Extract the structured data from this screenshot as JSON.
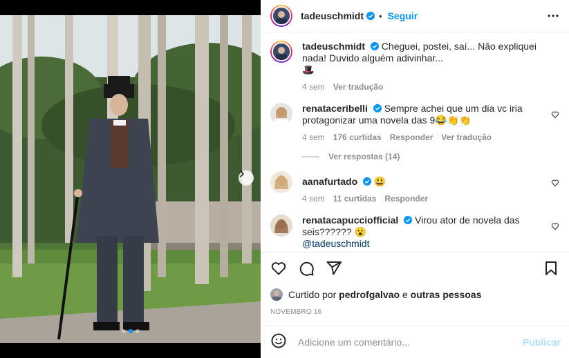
{
  "post": {
    "author": "tadeuschmidt",
    "separator": "•",
    "follow_label": "Seguir",
    "caption": {
      "text": "Cheguei, postei, saí... Não expliquei nada! Duvido alguém adivinhar...",
      "emoji": "🎩",
      "age": "4 sem",
      "translate": "Ver tradução"
    },
    "likes": {
      "prefix": "Curtido por",
      "user": "pedrofgalvao",
      "connector": "e",
      "others": "outras pessoas"
    },
    "date": "NOVEMBRO 16",
    "carousel": {
      "count": 3,
      "active": 1
    }
  },
  "comments": [
    {
      "user": "renataceribelli",
      "text": "Sempre achei que um dia vc iria protagonizar uma novela das 9😂👏👏",
      "age": "4 sem",
      "likes": "176 curtidas",
      "reply": "Responder",
      "translate": "Ver tradução",
      "view_replies": "Ver respostas (14)"
    },
    {
      "user": "aanafurtado",
      "text": "😃",
      "age": "4 sem",
      "likes": "11 curtidas",
      "reply": "Responder"
    },
    {
      "user": "renatacapucciofficial",
      "text": "Virou ator de novela das seis?????? 😮",
      "mention": "@tadeuschmidt"
    }
  ],
  "composer": {
    "placeholder": "Adicione um comentário...",
    "publish_label": "Publicar"
  },
  "colors": {
    "accent": "#0095f6",
    "verified": "#0095f6",
    "muted": "#8e8e8e",
    "publish_disabled": "#b2dffc"
  },
  "icons": {
    "more": "more-horizontal-icon",
    "heart": "heart-icon",
    "comment": "comment-icon",
    "share": "share-icon",
    "save": "bookmark-icon",
    "emoji": "emoji-icon",
    "next": "chevron-right-icon"
  }
}
